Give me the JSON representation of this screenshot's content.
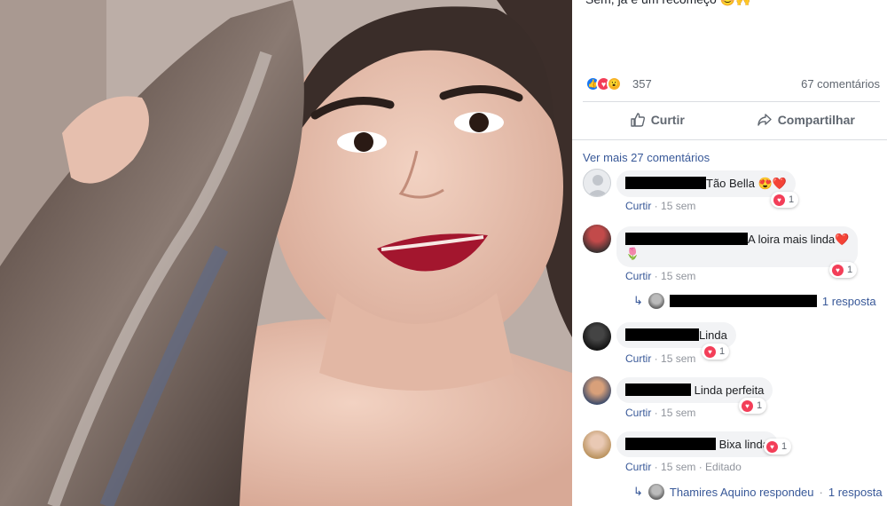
{
  "post": {
    "caption": "Sem, já é um recomeço 😊🙌",
    "reactions_count": "357",
    "comments_count": "67 comentários",
    "reactions": [
      {
        "icon": "like-reaction-icon",
        "glyph": "👍"
      },
      {
        "icon": "love-reaction-icon",
        "glyph": "♥"
      },
      {
        "icon": "wow-reaction-icon",
        "glyph": "😮"
      }
    ]
  },
  "actions": {
    "like": "Curtir",
    "share": "Compartilhar"
  },
  "view_more": "Ver mais 27 comentários",
  "comments": [
    {
      "text": "Tão Bella 😍❤️",
      "likes": "1",
      "like_label": "Curtir",
      "time": "15 sem"
    },
    {
      "text": "A loira mais linda❤️",
      "extra": "🌷",
      "likes": "1",
      "like_label": "Curtir",
      "time": "15 sem",
      "reply": "1 resposta"
    },
    {
      "text": "Linda",
      "likes": "1",
      "like_label": "Curtir",
      "time": "15 sem"
    },
    {
      "text": "Linda perfeita",
      "likes": "1",
      "like_label": "Curtir",
      "time": "15 sem"
    },
    {
      "text": "Bixa linda",
      "likes": "1",
      "like_label": "Curtir",
      "time": "15 sem",
      "edited": "Editado",
      "reply_author": "Thamires Aquino respondeu",
      "reply": "1 resposta"
    }
  ],
  "colors": {
    "link": "#385898",
    "bubble": "#f2f3f5",
    "love": "#f33e58",
    "like": "#1877f2"
  }
}
